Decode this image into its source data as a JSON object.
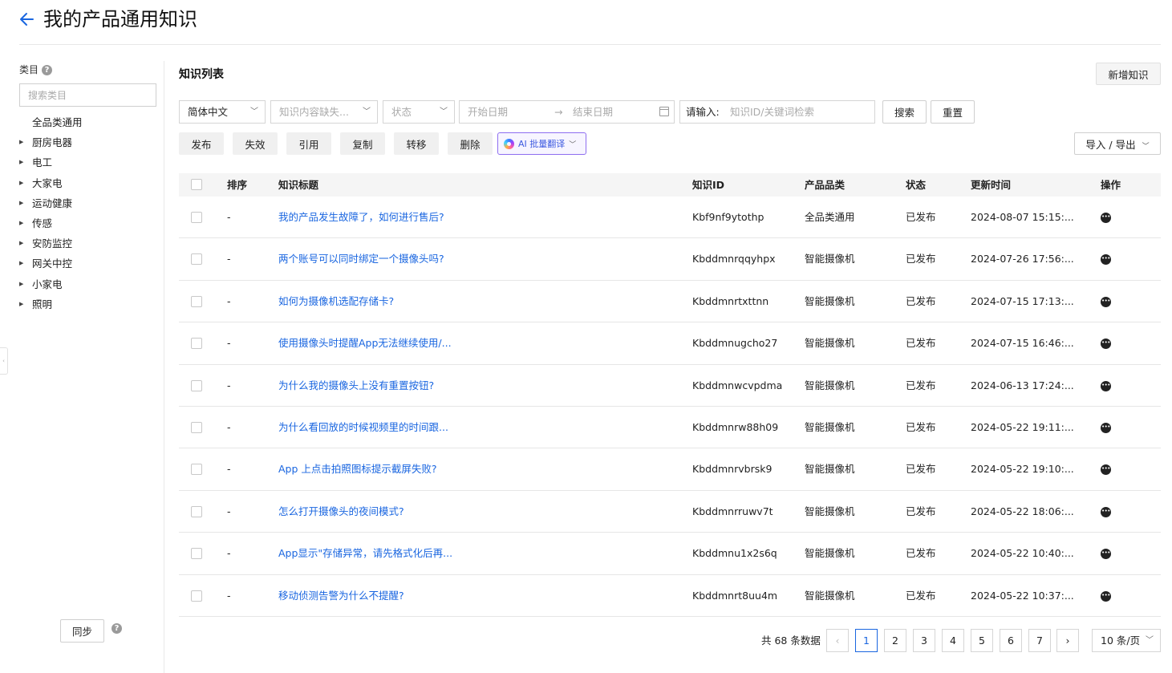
{
  "header": {
    "title": "我的产品通用知识"
  },
  "sidebar": {
    "label": "类目",
    "search_placeholder": "搜索类目",
    "items": [
      {
        "label": "全品类通用",
        "expandable": false
      },
      {
        "label": "厨房电器",
        "expandable": true
      },
      {
        "label": "电工",
        "expandable": true
      },
      {
        "label": "大家电",
        "expandable": true
      },
      {
        "label": "运动健康",
        "expandable": true
      },
      {
        "label": "传感",
        "expandable": true
      },
      {
        "label": "安防监控",
        "expandable": true
      },
      {
        "label": "网关中控",
        "expandable": true
      },
      {
        "label": "小家电",
        "expandable": true
      },
      {
        "label": "照明",
        "expandable": true
      }
    ],
    "sync_label": "同步"
  },
  "main": {
    "section_title": "知识列表",
    "add_label": "新增知识",
    "filters": {
      "language": "简体中文",
      "missing_content_placeholder": "知识内容缺失...",
      "status_placeholder": "状态",
      "start_date_placeholder": "开始日期",
      "end_date_placeholder": "结束日期",
      "keyword_label": "请输入:",
      "keyword_placeholder": "知识ID/关键词检索",
      "search_label": "搜索",
      "reset_label": "重置"
    },
    "actions": {
      "publish": "发布",
      "invalidate": "失效",
      "reference": "引用",
      "copy": "复制",
      "transfer": "转移",
      "delete": "删除",
      "ai_translate": "AI 批量翻译",
      "import_export": "导入 / 导出"
    },
    "table": {
      "columns": {
        "order": "排序",
        "title": "知识标题",
        "id": "知识ID",
        "category": "产品品类",
        "status": "状态",
        "updated": "更新时间",
        "ops": "操作"
      },
      "rows": [
        {
          "order": "-",
          "title": "我的产品发生故障了，如何进行售后?",
          "id": "Kbf9nf9ytothp",
          "category": "全品类通用",
          "status": "已发布",
          "updated": "2024-08-07 15:15:..."
        },
        {
          "order": "-",
          "title": "两个账号可以同时绑定一个摄像头吗?",
          "id": "Kbddmnrqqyhpx",
          "category": "智能摄像机",
          "status": "已发布",
          "updated": "2024-07-26 17:56:..."
        },
        {
          "order": "-",
          "title": "如何为摄像机选配存储卡?",
          "id": "Kbddmnrtxttnn",
          "category": "智能摄像机",
          "status": "已发布",
          "updated": "2024-07-15 17:13:..."
        },
        {
          "order": "-",
          "title": "使用摄像头时提醒App无法继续使用/...",
          "id": "Kbddmnugcho27",
          "category": "智能摄像机",
          "status": "已发布",
          "updated": "2024-07-15 16:46:..."
        },
        {
          "order": "-",
          "title": "为什么我的摄像头上没有重置按钮?",
          "id": "Kbddmnwcvpdma",
          "category": "智能摄像机",
          "status": "已发布",
          "updated": "2024-06-13 17:24:..."
        },
        {
          "order": "-",
          "title": "为什么看回放的时候视频里的时间跟...",
          "id": "Kbddmnrw88h09",
          "category": "智能摄像机",
          "status": "已发布",
          "updated": "2024-05-22 19:11:..."
        },
        {
          "order": "-",
          "title": "App 上点击拍照图标提示截屏失败?",
          "id": "Kbddmnrvbrsk9",
          "category": "智能摄像机",
          "status": "已发布",
          "updated": "2024-05-22 19:10:..."
        },
        {
          "order": "-",
          "title": "怎么打开摄像头的夜间模式?",
          "id": "Kbddmnrruwv7t",
          "category": "智能摄像机",
          "status": "已发布",
          "updated": "2024-05-22 18:06:..."
        },
        {
          "order": "-",
          "title": "App显示\"存储异常，请先格式化后再...",
          "id": "Kbddmnu1x2s6q",
          "category": "智能摄像机",
          "status": "已发布",
          "updated": "2024-05-22 10:40:..."
        },
        {
          "order": "-",
          "title": "移动侦测告警为什么不提醒?",
          "id": "Kbddmnrt8uu4m",
          "category": "智能摄像机",
          "status": "已发布",
          "updated": "2024-05-22 10:37:..."
        }
      ]
    },
    "pagination": {
      "total_text": "共 68 条数据",
      "pages": [
        "1",
        "2",
        "3",
        "4",
        "5",
        "6",
        "7"
      ],
      "current": "1",
      "page_size": "10 条/页"
    }
  },
  "colors": {
    "accent": "#1a66e0",
    "ai_border": "#8e6ef0"
  }
}
